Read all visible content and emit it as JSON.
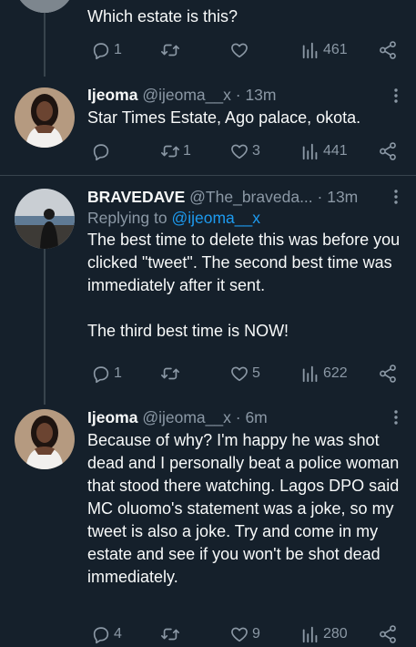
{
  "tweets": [
    {
      "body": "Which estate is this?",
      "actions": {
        "replies": "1",
        "retweets": "",
        "likes": "",
        "views": "461"
      }
    },
    {
      "name": "Ijeoma",
      "handle": "@ijeoma__x",
      "time": "· 13m",
      "body": "Star Times Estate, Ago palace, okota.",
      "actions": {
        "replies": "",
        "retweets": "1",
        "likes": "3",
        "views": "441"
      }
    },
    {
      "name": "BRAVEDAVE",
      "handle": "@The_braveda...",
      "time": "· 13m",
      "replying_prefix": "Replying to",
      "replying_to": "@ijeoma__x",
      "body": "The best time to delete this was before you clicked \"tweet\". The second best time was immediately after it sent.\n\nThe third best time is NOW!",
      "actions": {
        "replies": "1",
        "retweets": "",
        "likes": "5",
        "views": "622"
      }
    },
    {
      "name": "Ijeoma",
      "handle": "@ijeoma__x",
      "time": "· 6m",
      "body": "Because of why? I'm happy he was shot dead and I personally beat a police woman that stood there watching. Lagos DPO said MC oluomo's statement was a joke, so my tweet is also a joke. Try and come in my estate and see if you won't be shot dead immediately.",
      "actions": {
        "replies": "4",
        "retweets": "",
        "likes": "9",
        "views": "280"
      }
    }
  ],
  "icons": {
    "reply": "reply-icon",
    "retweet": "retweet-icon",
    "like": "heart-icon",
    "views": "views-icon",
    "share": "share-icon",
    "more": "more-icon"
  },
  "colors": {
    "background": "#15202b",
    "text": "#f7f9f9",
    "muted": "#8b98a5",
    "link": "#1d9bf0",
    "divider": "#38444d"
  }
}
